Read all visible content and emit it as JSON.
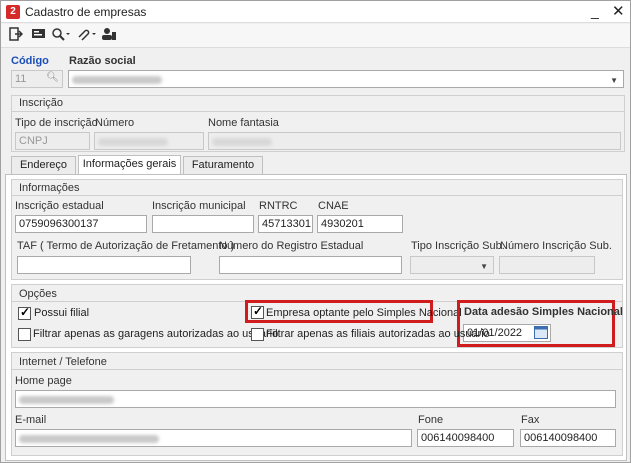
{
  "window": {
    "title": "Cadastro de empresas",
    "minimize": "_",
    "close": "✕"
  },
  "toolbar": {
    "items": [
      "exit-icon",
      "card-icon",
      "search-icon",
      "attach-icon",
      "user-icon"
    ]
  },
  "header": {
    "codigo_label": "Código",
    "razao_label": "Razão social",
    "codigo_value": "11"
  },
  "inscricao": {
    "title": "Inscrição",
    "tipo_label": "Tipo de inscrição",
    "numero_label": "Número",
    "fantasia_label": "Nome fantasia",
    "tipo_value": "CNPJ"
  },
  "tabs": [
    {
      "label": "Endereço"
    },
    {
      "label": "Informações gerais"
    },
    {
      "label": "Faturamento"
    }
  ],
  "informacoes": {
    "title": "Informações",
    "estadual_label": "Inscrição estadual",
    "estadual_value": "0759096300137",
    "municipal_label": "Inscrição municipal",
    "rntrc_label": "RNTRC",
    "rntrc_value": "45713301",
    "cnae_label": "CNAE",
    "cnae_value": "4930201",
    "taf_label": "TAF ( Termo de Autorização de Fretamento )",
    "registro_label": "Número do Registro Estadual",
    "tipo_sub_label": "Tipo Inscrição Sub.",
    "numero_sub_label": "Número Inscrição Sub."
  },
  "opcoes": {
    "title": "Opções",
    "possui_filial": "Possui filial",
    "simples": "Empresa optante pelo Simples Nacional",
    "data_adesao_label": "Data adesão Simples Nacional",
    "data_adesao_value": "01/01/2022",
    "filtrar_garagens": "Filtrar apenas as garagens autorizadas ao usuário",
    "filtrar_filiais": "Filtrar apenas as filiais autorizadas ao usuário"
  },
  "internet": {
    "title": "Internet / Telefone",
    "homepage_label": "Home page",
    "email_label": "E-mail",
    "fone_label": "Fone",
    "fone_value": "006140098400",
    "fax_label": "Fax",
    "fax_value": "006140098400"
  }
}
